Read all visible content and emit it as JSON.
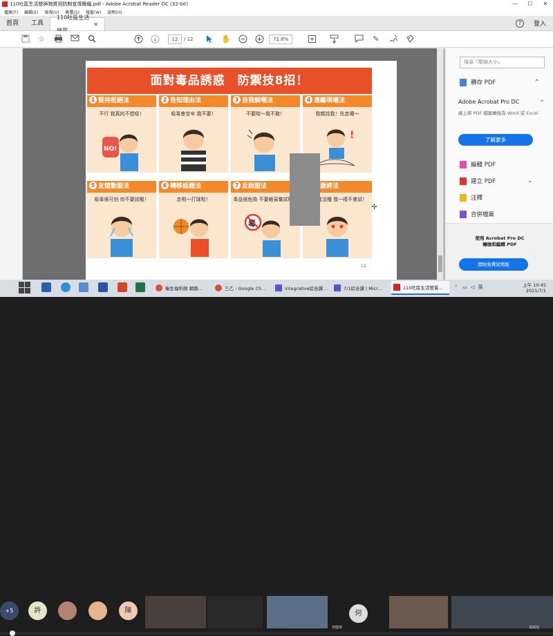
{
  "window": {
    "title": "110吐區生活營與物質用防制宣導簡報.pdf - Adobe Acrobat Reader DC (32-bit)",
    "controls": [
      "—",
      "☐",
      "✕"
    ]
  },
  "menu": [
    "檔案(F)",
    "編輯(E)",
    "檢視(V)",
    "簽署(S)",
    "視窗(W)",
    "說明(H)"
  ],
  "tabs": {
    "home": "首頁",
    "tools": "工具",
    "document": "110吐區生活營貫..."
  },
  "header_right": {
    "help": "?",
    "signin": "登入"
  },
  "toolbar": {
    "page_current": "12",
    "page_total": "/ 12",
    "zoom": "72.8%"
  },
  "poster": {
    "title": "面對毒品誘惑　防禦技8招！",
    "methods": [
      {
        "num": "1",
        "label": "堅持拒絕法",
        "caption": "不行  我真的不想吸！"
      },
      {
        "num": "2",
        "label": "告知理由法",
        "caption": "吸毒會坐牢  我不要！"
      },
      {
        "num": "3",
        "label": "自我解嘲法",
        "caption": "不要啦～我不敢！"
      },
      {
        "num": "4",
        "label": "遠離現場法",
        "caption": "我媽找我！先走囉～"
      },
      {
        "num": "5",
        "label": "友誼勸服法",
        "caption": "吸毒很可怕  你不要試喔！"
      },
      {
        "num": "6",
        "label": "轉移話題法",
        "caption": "走啦～打球啦！"
      },
      {
        "num": "7",
        "label": "反說服法",
        "caption": "毒品很危險  不要輕易嘗試喔！"
      },
      {
        "num": "8",
        "label": "反激將法",
        "caption": "你說我沒種  我一樣不會試！"
      }
    ],
    "page_number": "12"
  },
  "right_panel": {
    "search_placeholder": "搜尋「壓縮大小」",
    "export_pdf": "轉存 PDF",
    "promo_title": "Adobe Acrobat Pro DC",
    "promo_desc": "線上將 PDF 檔案轉換為 Word 或 Excel",
    "learn_more": "了解更多",
    "tools": [
      "編輯 PDF",
      "建立 PDF",
      "注釋",
      "合併檔案"
    ],
    "bottom_promo": "使用 Acrobat Pro DC\n轉換和編輯 PDF",
    "trial": "開始免費試用版"
  },
  "taskbar": {
    "apps": [
      "衛生福利部 網路...",
      "三乙 - Google Ch...",
      "integrative綜合課...",
      "7/1綜合課 | Micr...",
      "110吐區生活營貫..."
    ],
    "ime": "英",
    "time": "上午 10:45",
    "date": "2021/7/1"
  },
  "meeting": {
    "more_count": "+5",
    "avatars": [
      "許",
      "陳",
      "何"
    ],
    "names": [
      "何健瑋",
      "張鈺瑄"
    ]
  },
  "colors": {
    "banner": "#e8502a",
    "header": "#f28a2c",
    "accent": "#1473e6"
  }
}
